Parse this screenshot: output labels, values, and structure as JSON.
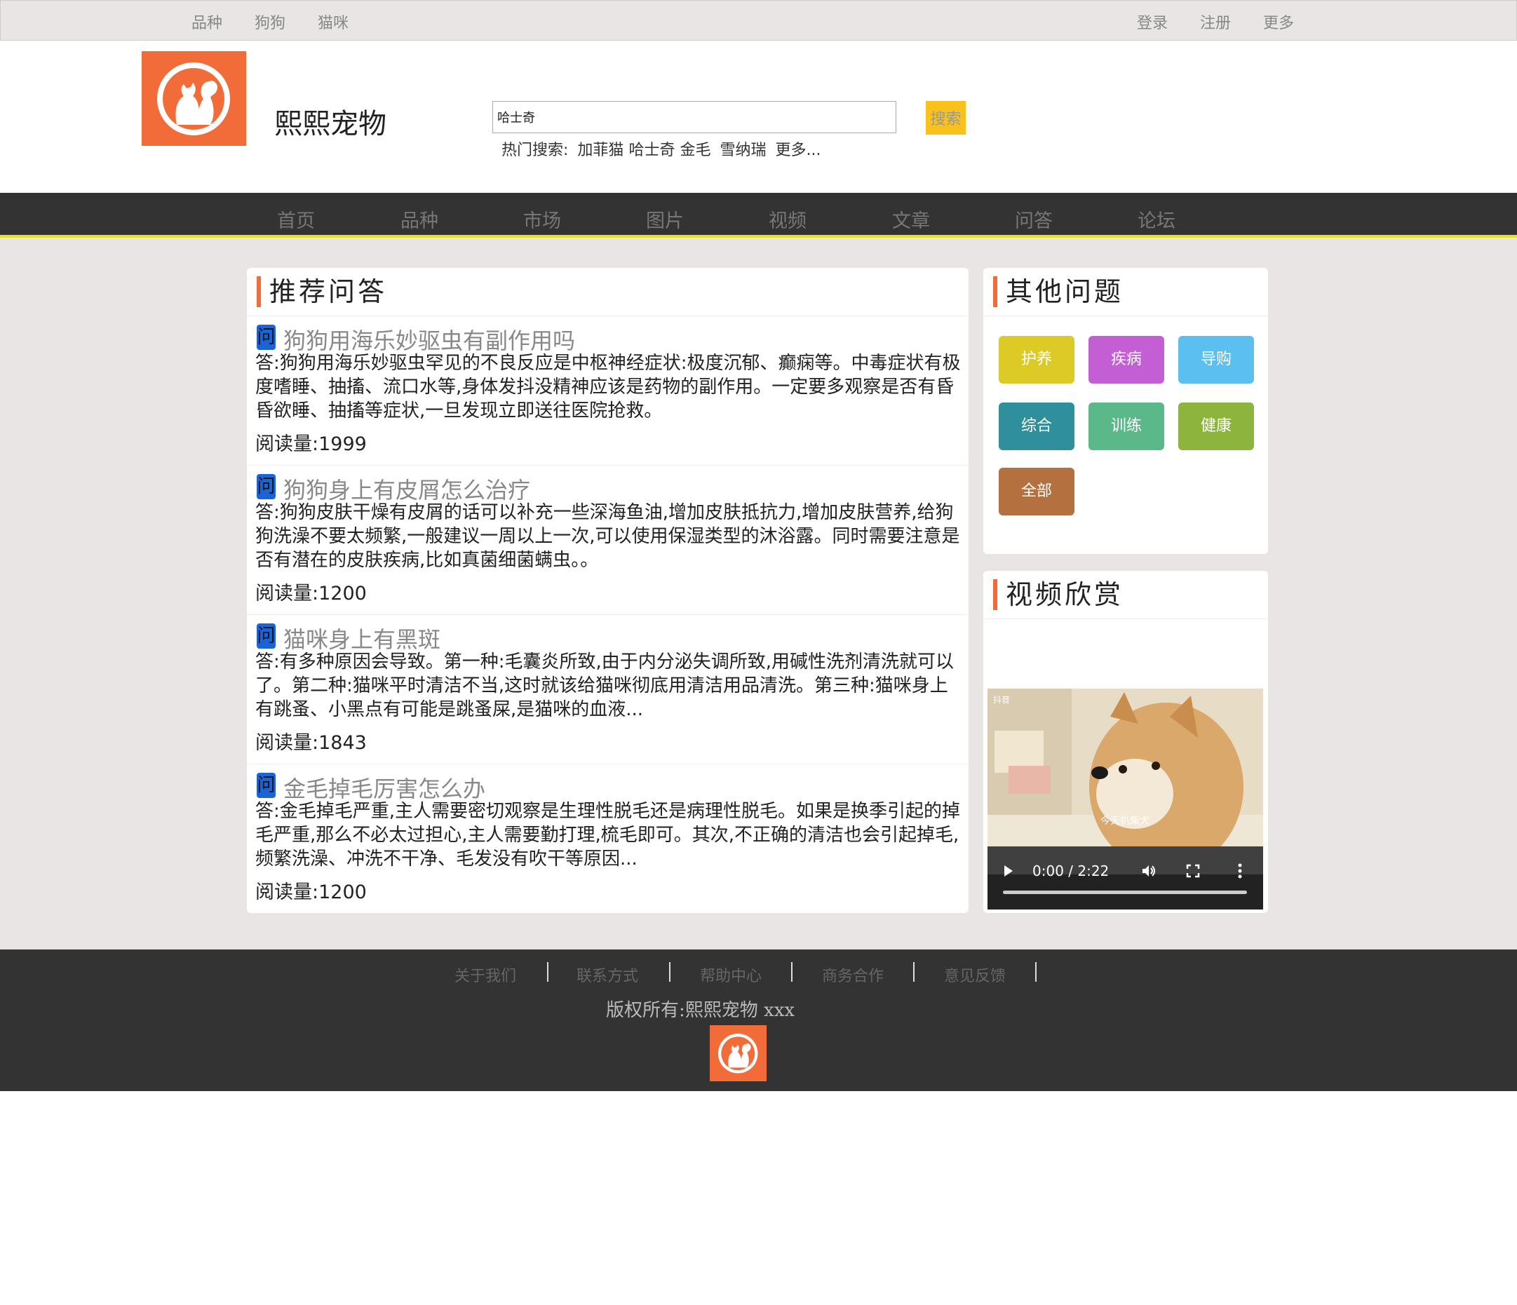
{
  "topbar": {
    "left_links": [
      "品种",
      "狗狗",
      "猫咪"
    ],
    "right_links": [
      "登录",
      "注册",
      "更多"
    ]
  },
  "header": {
    "site_name": "熙熙宠物",
    "search_value": "哈士奇",
    "search_button": "搜索",
    "hot_label": "热门搜索:",
    "hot_items": [
      "加菲猫",
      "哈士奇",
      "金毛",
      "雪纳瑞",
      "更多..."
    ]
  },
  "nav": [
    "首页",
    "品种",
    "市场",
    "图片",
    "视频",
    "文章",
    "问答",
    "论坛"
  ],
  "recommend": {
    "title": "推荐问答",
    "q_icon": "问",
    "items": [
      {
        "question": "狗狗用海乐妙驱虫有副作用吗",
        "answer": "答:狗狗用海乐妙驱虫罕见的不良反应是中枢神经症状:极度沉郁、癫痫等。中毒症状有极度嗜睡、抽搐、流口水等,身体发抖没精神应该是药物的副作用。一定要多观察是否有昏昏欲睡、抽搐等症状,一旦发现立即送往医院抢救。",
        "reads": "阅读量:1999"
      },
      {
        "question": "狗狗身上有皮屑怎么治疗",
        "answer": "答:狗狗皮肤干燥有皮屑的话可以补充一些深海鱼油,增加皮肤抵抗力,增加皮肤营养,给狗狗洗澡不要太频繁,一般建议一周以上一次,可以使用保湿类型的沐浴露。同时需要注意是否有潜在的皮肤疾病,比如真菌细菌螨虫。。",
        "reads": "阅读量:1200"
      },
      {
        "question": "猫咪身上有黑斑",
        "answer": "答:有多种原因会导致。第一种:毛囊炎所致,由于内分泌失调所致,用碱性洗剂清洗就可以了。第二种:猫咪平时清洁不当,这时就该给猫咪彻底用清洁用品清洗。第三种:猫咪身上有跳蚤、小黑点有可能是跳蚤屎,是猫咪的血液...",
        "reads": "阅读量:1843"
      },
      {
        "question": "金毛掉毛厉害怎么办",
        "answer": "答:金毛掉毛严重,主人需要密切观察是生理性脱毛还是病理性脱毛。如果是换季引起的掉毛严重,那么不必太过担心,主人需要勤打理,梳毛即可。其次,不正确的清洁也会引起掉毛,频繁洗澡、冲洗不干净、毛发没有吹干等原因...",
        "reads": "阅读量:1200"
      }
    ]
  },
  "other": {
    "title": "其他问题",
    "categories": [
      {
        "label": "护养",
        "color": "#dccb26"
      },
      {
        "label": "疾病",
        "color": "#c35ed4"
      },
      {
        "label": "导购",
        "color": "#5bbff0"
      },
      {
        "label": "综合",
        "color": "#2f8f9a"
      },
      {
        "label": "训练",
        "color": "#5bb889"
      },
      {
        "label": "健康",
        "color": "#8db43c"
      },
      {
        "label": "全部",
        "color": "#b5703f"
      }
    ]
  },
  "video": {
    "title": "视频欣赏",
    "watermark": "抖音",
    "caption": "今天扒柴犬",
    "time": "0:00 / 2:22"
  },
  "footer": {
    "links": [
      "关于我们",
      "联系方式",
      "帮助中心",
      "商务合作",
      "意见反馈"
    ],
    "copyright": "版权所有:熙熙宠物 xxx"
  },
  "colors": {
    "brand": "#f26c3a",
    "accent": "#f8c21b",
    "nav_underline": "#e8e21a",
    "dark": "#333333"
  }
}
